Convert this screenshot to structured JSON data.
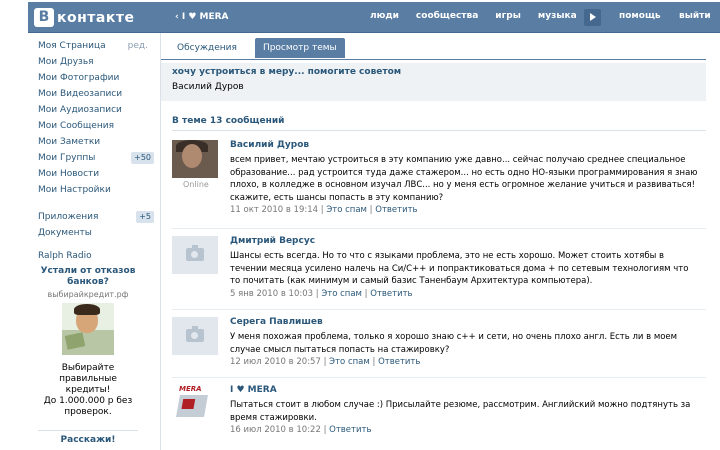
{
  "header": {
    "logo_letter": "В",
    "logo_text": "контакте",
    "group_crumb": "‹ I ♥ MERA",
    "nav": [
      "люди",
      "сообщества",
      "игры",
      "музыка"
    ],
    "help": "помощь",
    "logout": "выйти"
  },
  "sidebar": {
    "items": [
      {
        "label": "Моя Страница",
        "extra": "ред."
      },
      {
        "label": "Мои Друзья"
      },
      {
        "label": "Мои Фотографии"
      },
      {
        "label": "Мои Видеозаписи"
      },
      {
        "label": "Мои Аудиозаписи"
      },
      {
        "label": "Мои Сообщения"
      },
      {
        "label": "Мои Заметки"
      },
      {
        "label": "Мои Группы",
        "badge": "+50"
      },
      {
        "label": "Мои Новости"
      },
      {
        "label": "Мои Настройки"
      }
    ],
    "apps": [
      {
        "label": "Приложения",
        "badge": "+5"
      },
      {
        "label": "Документы"
      }
    ],
    "radio": "Ralph Radio"
  },
  "ad": {
    "title": "Устали от отказов банков?",
    "site": "выбирайкредит.рф",
    "text_1": "Выбирайте",
    "text_2": "правильные",
    "text_3": "кредиты!",
    "text_4": "До 1.000.000 р без",
    "text_5": "проверок.",
    "more": "Расскажи!"
  },
  "tabs": [
    "Обсуждения",
    "Просмотр темы"
  ],
  "topic": {
    "title": "хочу устроиться в меру... помогите советом",
    "author": "Василий Дуров"
  },
  "count": "В теме 13 сообщений",
  "posts": [
    {
      "author": "Василий Дуров",
      "online": "Online",
      "text": "всем привет, мечтаю устроиться в эту компанию уже давно... сейчас получаю среднее специальное образование... рад устроится туда даже стажером... но есть одно НО-языки программирования я знаю плохо, в колледже в основном изучал ЛВС... но у меня есть огромное желание учиться и развиваться! скажите, есть шансы попасть в эту компанию?",
      "date": "11 окт 2010 в 19:14",
      "sep": "|",
      "action_1": "Это спам",
      "action_2": "Ответить"
    },
    {
      "author": "Дмитрий Версус",
      "text": "Шансы есть всегда. Но то что с языками проблема, это не есть хорошо. Может стоить хотябы в течении месяца усилено налечь на Си/С++ и попрактиковаться дома + по сетевым технологиям что то почитать (как минимум и самый базис Таненбаум Архитектура компьютера).",
      "date": "5 янв 2010 в 10:03",
      "sep": "|",
      "action_1": "Это спам",
      "action_2": "Ответить"
    },
    {
      "author": "Серега Павлишев",
      "text": "У меня похожая проблема, только я хорошо знаю с++ и сети, но очень плохо англ. Есть ли в моем случае смысл пытаться попасть на стажировку?",
      "date": "12 июл 2010 в 20:57",
      "sep": "|",
      "action_1": "Это спам",
      "action_2": "Ответить"
    },
    {
      "author": "I ♥ MERA",
      "logo": "MERA",
      "text": "Пытаться стоит в любом случае :) Присылайте резюме, рассмотрим. Английский можно подтянуть за время стажировки.",
      "date": "16 июл 2010 в 10:22",
      "sep": "|",
      "action_2": "Ответить"
    }
  ]
}
